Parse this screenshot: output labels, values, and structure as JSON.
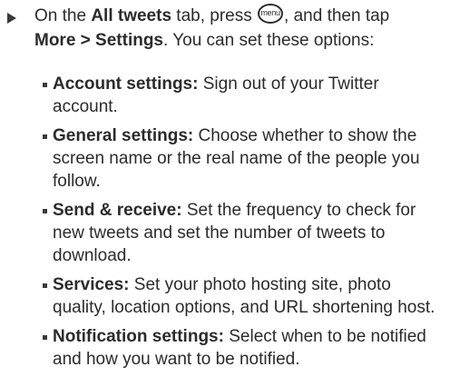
{
  "intro": {
    "t1": "On the ",
    "all_tweets": "All tweets",
    "t2": " tab, press ",
    "menu_key": "menu",
    "t3": ", and then tap",
    "more_settings": "More > Settings",
    "t4": ". You can set these options:"
  },
  "options": [
    {
      "term": "Account settings:",
      "desc": " Sign out of your Twitter account."
    },
    {
      "term": "General settings:",
      "desc": " Choose whether to show the screen name or the real name of the people you follow."
    },
    {
      "term": "Send & receive:",
      "desc": " Set the frequency to check for new tweets and set the number of tweets to download."
    },
    {
      "term": "Services:",
      "desc": " Set your photo hosting site, photo quality, location options, and URL shortening host."
    },
    {
      "term": "Notification settings:",
      "desc": " Select when to be notified and how you want to be notified."
    }
  ]
}
